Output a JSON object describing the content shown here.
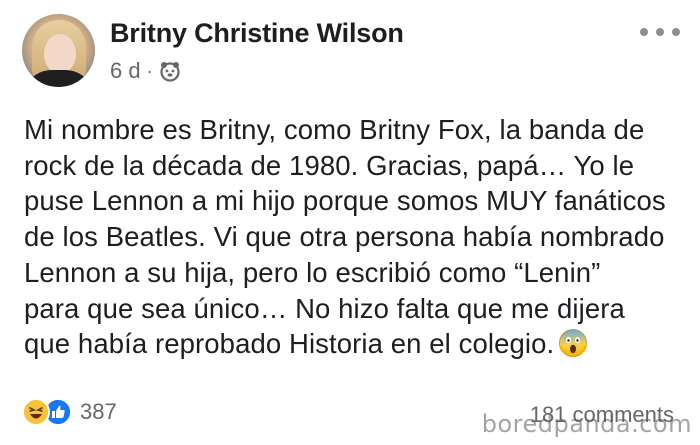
{
  "post": {
    "author_name": "Britny Christine Wilson",
    "time": "6 d",
    "separator": "·",
    "audience_icon": "friends-icon",
    "text_lines": [
      "Mi nombre es Britny, como Britny Fox, la banda de",
      "rock de la década de 1980. Gracias, papá… Yo le",
      "puse Lennon a mi hijo porque somos MUY fanáticos",
      "de los Beatles. Vi que otra persona había nombrado",
      "Lennon a su hija, pero lo escribió como “Lenin”",
      "para que sea único… No hizo falta que me dijera",
      "que había reprobado Historia en el colegio."
    ],
    "end_emoji": "face-screaming-in-fear-icon"
  },
  "footer": {
    "reaction_icons": [
      "haha-reaction-icon",
      "like-reaction-icon"
    ],
    "reaction_count": "387",
    "comments": "181 comments"
  },
  "watermark": {
    "text": "boredpanda.com"
  },
  "colors": {
    "text": "#1c1e21",
    "secondary": "#65676b",
    "like_blue": "#1877f2",
    "haha_yellow": "#f7c33b"
  }
}
